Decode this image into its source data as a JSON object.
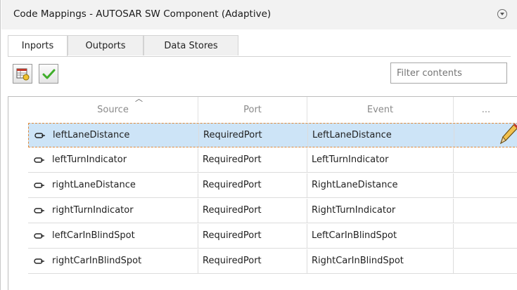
{
  "window": {
    "title": "Code Mappings - AUTOSAR SW Component (Adaptive)"
  },
  "tabs": [
    {
      "label": "Inports"
    },
    {
      "label": "Outports"
    },
    {
      "label": "Data Stores"
    }
  ],
  "toolbar": {
    "mapping_button_icon": "table-settings-icon",
    "validate_button_icon": "checkmark-icon",
    "filter_placeholder": "Filter contents"
  },
  "table": {
    "columns": [
      "Source",
      "Port",
      "Event",
      "..."
    ],
    "rows": [
      {
        "source": "leftLaneDistance",
        "port": "RequiredPort",
        "event": "LeftLaneDistance"
      },
      {
        "source": "leftTurnIndicator",
        "port": "RequiredPort",
        "event": "LeftTurnIndicator"
      },
      {
        "source": "rightLaneDistance",
        "port": "RequiredPort",
        "event": "RightLaneDistance"
      },
      {
        "source": "rightTurnIndicator",
        "port": "RequiredPort",
        "event": "RightTurnIndicator"
      },
      {
        "source": "leftCarInBlindSpot",
        "port": "RequiredPort",
        "event": "LeftCarInBlindSpot"
      },
      {
        "source": "rightCarInBlindSpot",
        "port": "RequiredPort",
        "event": "RightCarInBlindSpot"
      }
    ],
    "selected_row": 0
  },
  "colors": {
    "selection": "#cde4f7",
    "selection_border": "#e08a3a",
    "check_green": "#3fae2a"
  }
}
